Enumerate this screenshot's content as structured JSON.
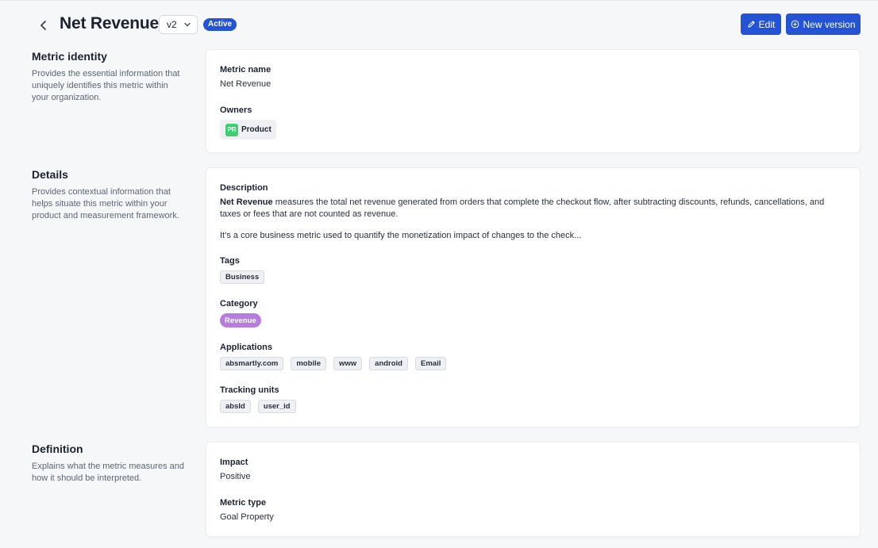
{
  "header": {
    "title": "Net Revenue",
    "version": "v2",
    "status": "Active",
    "edit_label": "Edit",
    "new_version_label": "New version"
  },
  "identity": {
    "title": "Metric identity",
    "description": "Provides the essential information that uniquely identifies this metric within your organization.",
    "metric_name_label": "Metric name",
    "metric_name": "Net Revenue",
    "owners_label": "Owners",
    "owner": {
      "initials": "PR",
      "name": "Product",
      "color": "#3ecf6e"
    }
  },
  "details": {
    "title": "Details",
    "description": "Provides contextual information that helps situate this metric within your product and measurement framework.",
    "description_label": "Description",
    "description_bold": "Net Revenue",
    "description_rest": " measures the total net revenue generated from orders that complete the checkout flow, after subtracting discounts, refunds, cancellations, and taxes or fees that are not counted as revenue.",
    "description_para2": "It’s a core business metric used to quantify the monetization impact of changes to the check...",
    "tags_label": "Tags",
    "tags": [
      "Business"
    ],
    "category_label": "Category",
    "category": "Revenue",
    "category_color": "#b77ce0",
    "applications_label": "Applications",
    "applications": [
      "absmartly.com",
      "mobile",
      "www",
      "android",
      "Email"
    ],
    "tracking_units_label": "Tracking units",
    "tracking_units": [
      "absId",
      "user_id"
    ]
  },
  "definition": {
    "title": "Definition",
    "description": "Explains what the metric measures and how it should be interpreted.",
    "impact_label": "Impact",
    "impact": "Positive",
    "metric_type_label": "Metric type",
    "metric_type": "Goal Property"
  },
  "colors": {
    "primary": "#2453d6",
    "background": "#f6f7f9"
  }
}
